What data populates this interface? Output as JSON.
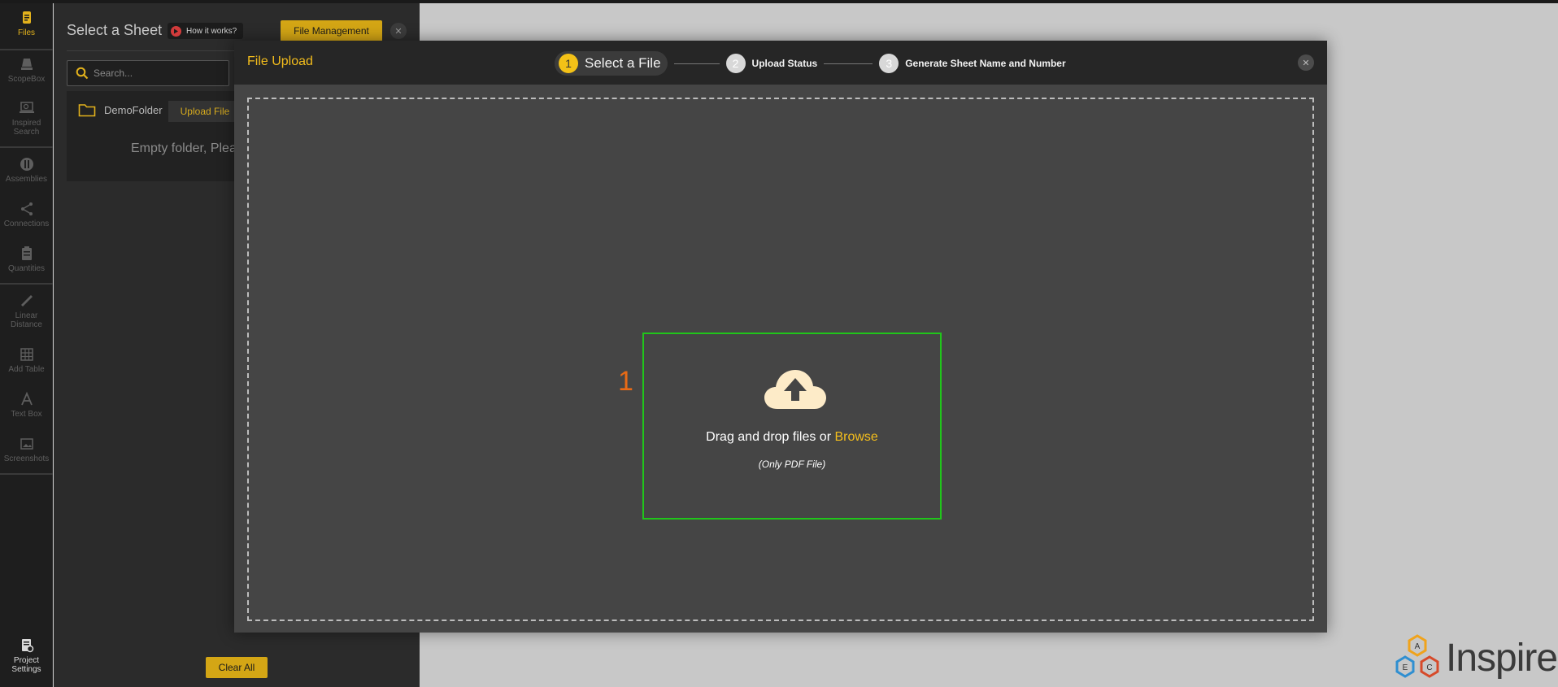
{
  "sidebar": {
    "items": [
      {
        "label": "Files",
        "icon": "file-icon",
        "active": true
      },
      {
        "label": "ScopeBox",
        "icon": "scopebox-icon"
      },
      {
        "label": "Inspired\nSearch",
        "icon": "laptop-search-icon"
      },
      {
        "label": "Assemblies",
        "icon": "assemblies-icon"
      },
      {
        "label": "Connections",
        "icon": "connections-icon"
      },
      {
        "label": "Quantities",
        "icon": "clipboard-icon"
      },
      {
        "label": "Linear\nDistance",
        "icon": "ruler-icon"
      },
      {
        "label": "Add Table",
        "icon": "table-icon"
      },
      {
        "label": "Text Box",
        "icon": "text-icon"
      },
      {
        "label": "Screenshots",
        "icon": "image-icon"
      }
    ],
    "bottom": {
      "label": "Project\nSettings",
      "icon": "project-settings-icon"
    }
  },
  "panel": {
    "title": "Select a Sheet",
    "how_it_works": "How it works?",
    "file_management": "File Management",
    "search_placeholder": "Search...",
    "folder_name": "DemoFolder",
    "upload_file": "Upload File",
    "empty_message": "Empty folder, Plea",
    "clear_all": "Clear All"
  },
  "modal": {
    "title": "File Upload",
    "steps": [
      {
        "number": "1",
        "label": "Select a File",
        "active": true
      },
      {
        "number": "2",
        "label": "Upload Status"
      },
      {
        "number": "3",
        "label": "Generate Sheet Name and Number"
      }
    ],
    "step_marker": "1",
    "drag_text": "Drag and drop files or ",
    "browse": "Browse",
    "hint": "(Only PDF File)"
  },
  "brand": {
    "name": "Inspire",
    "hex_letters": [
      "A",
      "E",
      "C"
    ]
  },
  "colors": {
    "accent": "#f3c117",
    "dropzone_border": "#20c51a",
    "step_marker": "#e86a16"
  }
}
